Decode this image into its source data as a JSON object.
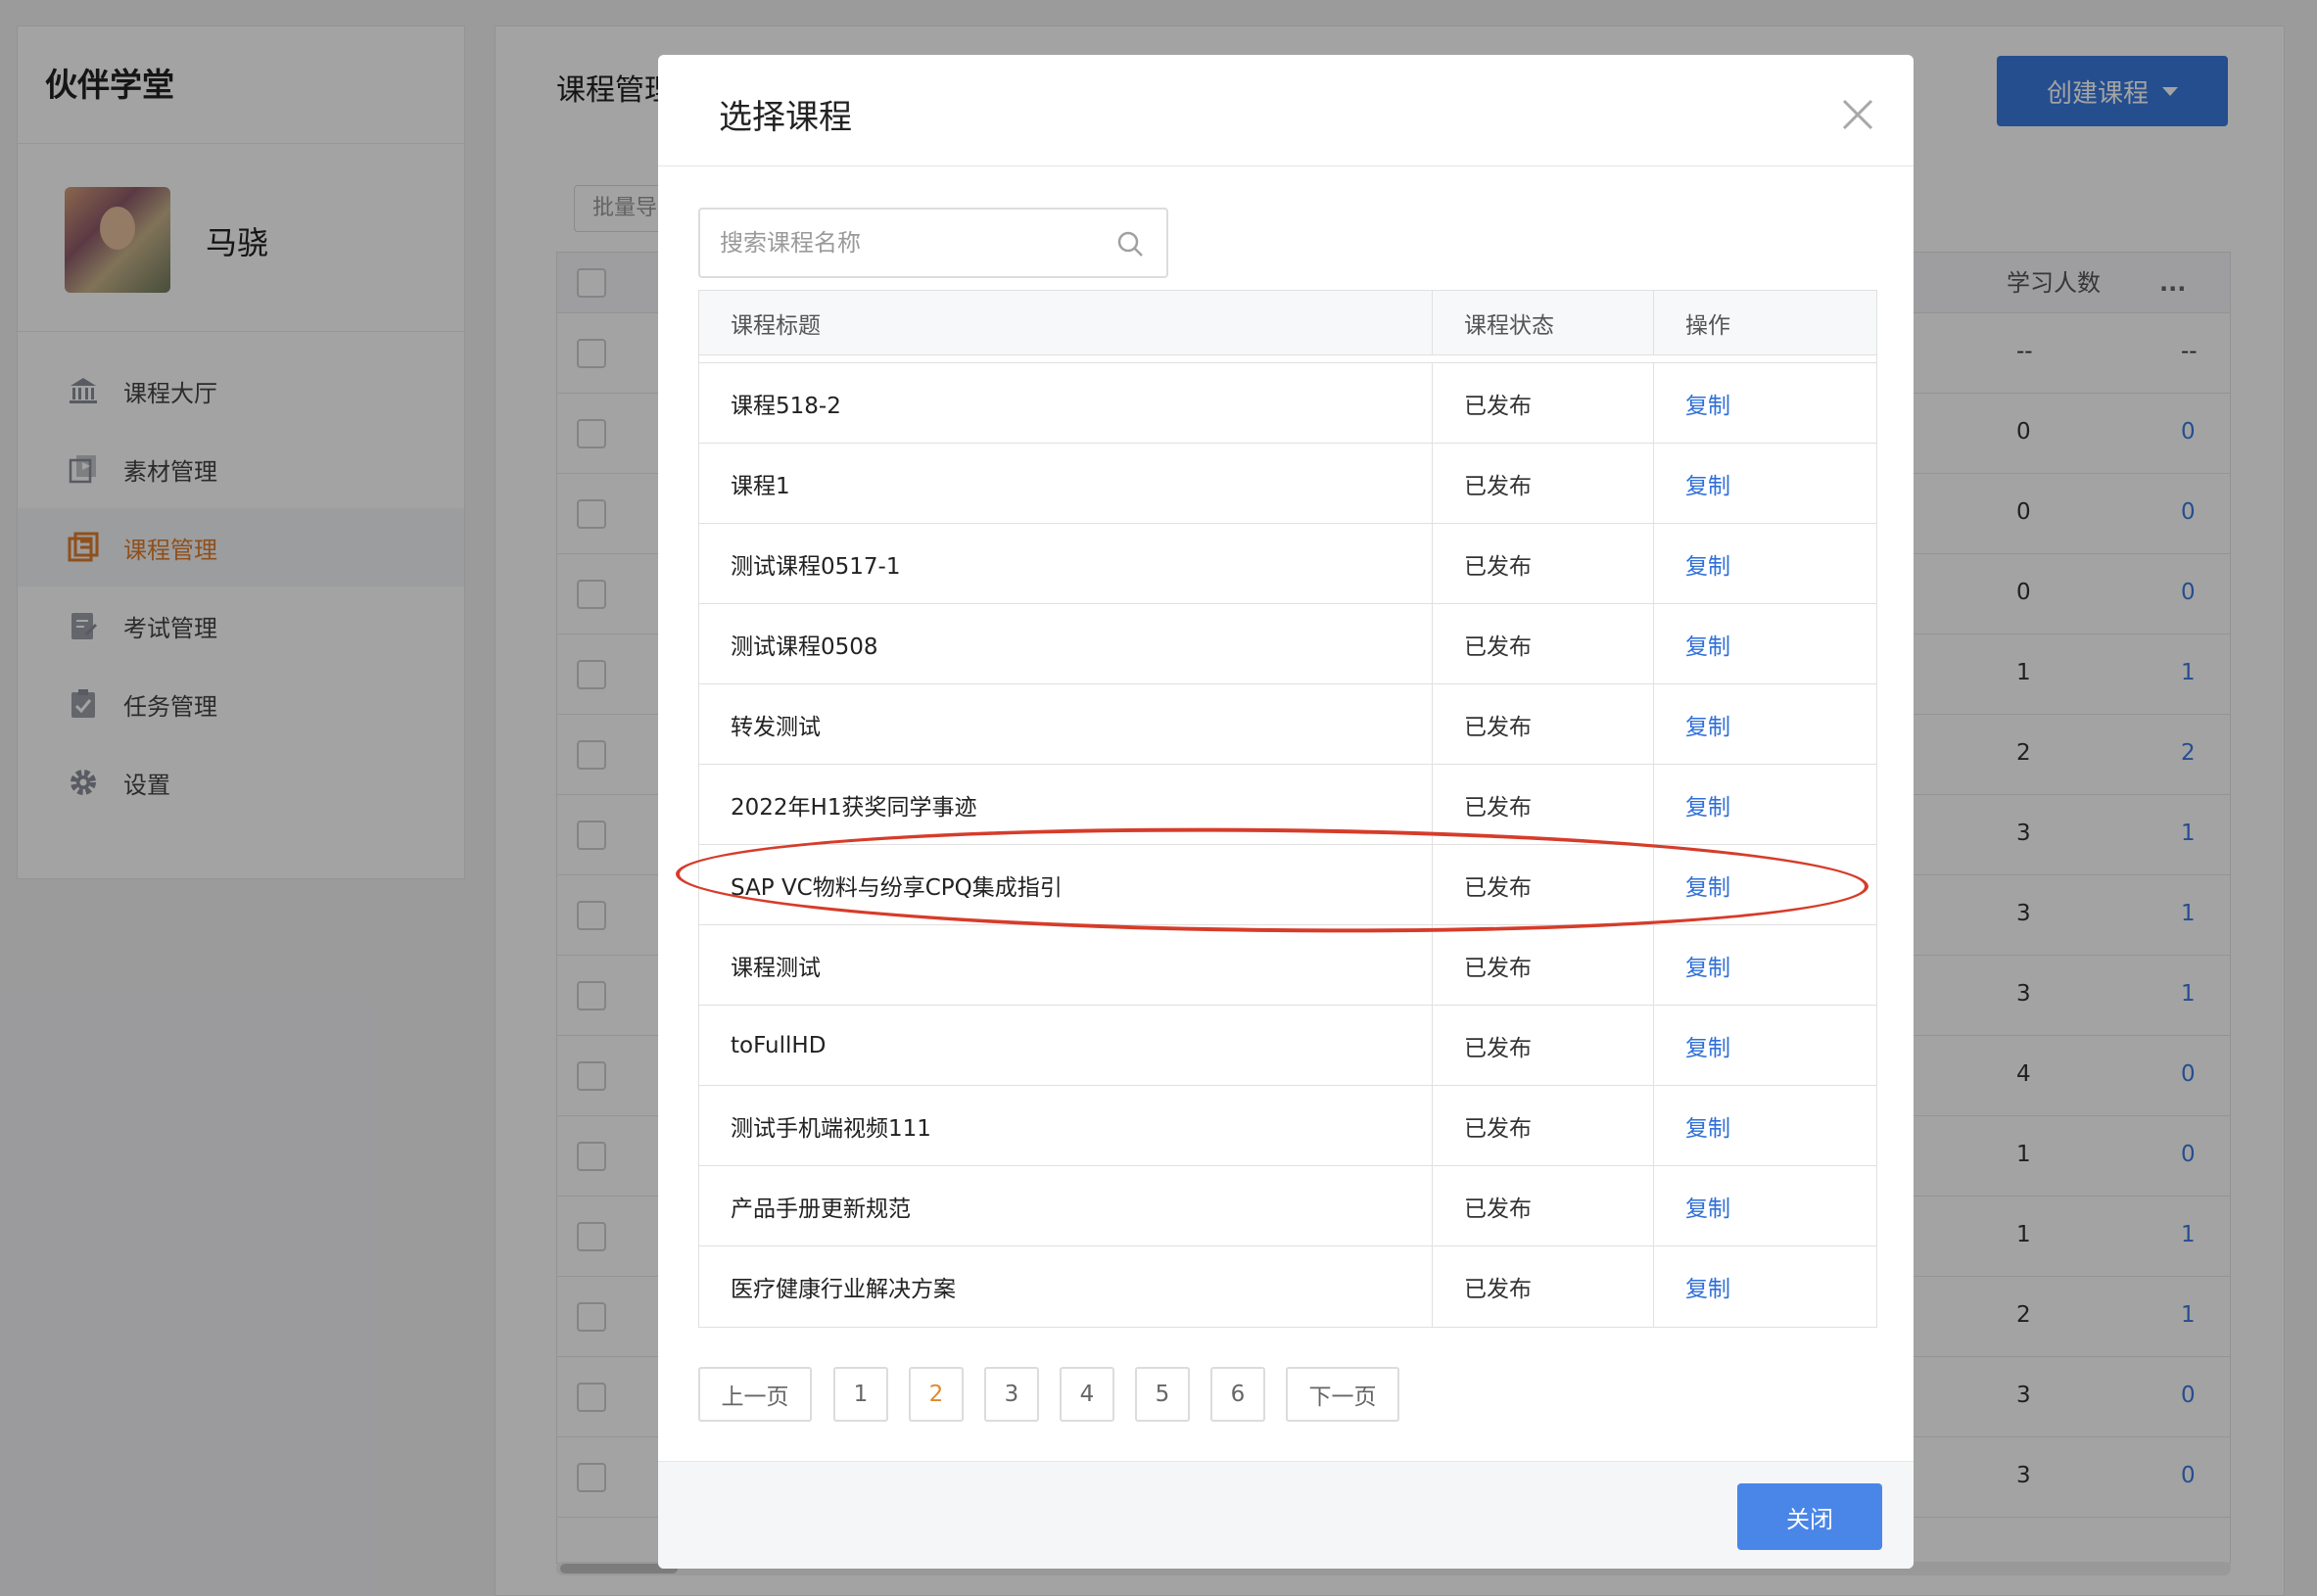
{
  "sidebar": {
    "brand": "伙伴学堂",
    "user_name": "马骁",
    "items": [
      {
        "label": "课程大厅",
        "icon": "bank-icon"
      },
      {
        "label": "素材管理",
        "icon": "media-icon"
      },
      {
        "label": "课程管理",
        "icon": "course-icon",
        "active": true
      },
      {
        "label": "考试管理",
        "icon": "exam-icon"
      },
      {
        "label": "任务管理",
        "icon": "task-icon"
      },
      {
        "label": "设置",
        "icon": "gear-icon"
      }
    ]
  },
  "main": {
    "title": "课程管理",
    "batch_label": "批量导",
    "create_label": "创建课程",
    "columns": [
      "数",
      "学习人数",
      "..."
    ],
    "rows": [
      {
        "a": "--",
        "b": "--"
      },
      {
        "a": "0",
        "b": "0"
      },
      {
        "a": "0",
        "b": "0"
      },
      {
        "a": "0",
        "b": "0"
      },
      {
        "a": "1",
        "b": "1"
      },
      {
        "a": "2",
        "b": "2"
      },
      {
        "a": "3",
        "b": "1"
      },
      {
        "a": "3",
        "b": "1"
      },
      {
        "a": "3",
        "b": "1"
      },
      {
        "a": "4",
        "b": "0"
      },
      {
        "a": "1",
        "b": "0"
      },
      {
        "a": "1",
        "b": "1"
      },
      {
        "a": "2",
        "b": "1"
      },
      {
        "a": "3",
        "b": "0"
      },
      {
        "a": "3",
        "b": "0"
      }
    ]
  },
  "modal": {
    "title": "选择课程",
    "search_placeholder": "搜索课程名称",
    "columns": {
      "title": "课程标题",
      "status": "课程状态",
      "action": "操作"
    },
    "rows": [
      {
        "title": "课程518-2",
        "status": "已发布",
        "action": "复制"
      },
      {
        "title": "课程1",
        "status": "已发布",
        "action": "复制"
      },
      {
        "title": "测试课程0517-1",
        "status": "已发布",
        "action": "复制"
      },
      {
        "title": "测试课程0508",
        "status": "已发布",
        "action": "复制"
      },
      {
        "title": "转发测试",
        "status": "已发布",
        "action": "复制"
      },
      {
        "title": "2022年H1获奖同学事迹",
        "status": "已发布",
        "action": "复制"
      },
      {
        "title": "SAP VC物料与纷享CPQ集成指引",
        "status": "已发布",
        "action": "复制",
        "highlighted": true
      },
      {
        "title": "课程测试",
        "status": "已发布",
        "action": "复制"
      },
      {
        "title": "toFullHD",
        "status": "已发布",
        "action": "复制"
      },
      {
        "title": "测试手机端视频111",
        "status": "已发布",
        "action": "复制"
      },
      {
        "title": "产品手册更新规范",
        "status": "已发布",
        "action": "复制"
      },
      {
        "title": "医疗健康行业解决方案",
        "status": "已发布",
        "action": "复制"
      }
    ],
    "pagination": {
      "prev": "上一页",
      "pages": [
        "1",
        "2",
        "3",
        "4",
        "5",
        "6"
      ],
      "current": "2",
      "next": "下一页"
    },
    "close_label": "关闭"
  },
  "colors": {
    "accent_blue": "#3b7be0",
    "active_orange": "#e07d2c",
    "link_blue": "#2f6fd8",
    "highlight_red": "#d63c2a"
  }
}
